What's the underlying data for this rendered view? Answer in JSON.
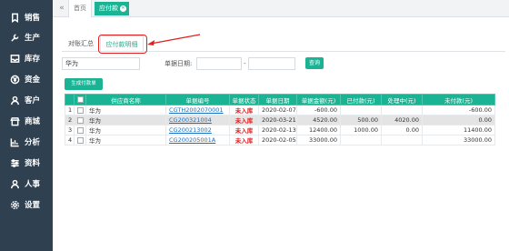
{
  "sidebar": {
    "items": [
      {
        "label": "销售",
        "icon": "bookmark-icon"
      },
      {
        "label": "生产",
        "icon": "wrench-icon"
      },
      {
        "label": "库存",
        "icon": "inbox-icon"
      },
      {
        "label": "资金",
        "icon": "cny-icon"
      },
      {
        "label": "客户",
        "icon": "user-icon"
      },
      {
        "label": "商城",
        "icon": "shop-icon"
      },
      {
        "label": "分析",
        "icon": "chart-icon"
      },
      {
        "label": "资料",
        "icon": "sliders-icon"
      },
      {
        "label": "人事",
        "icon": "user-icon"
      },
      {
        "label": "设置",
        "icon": "gear-icon"
      }
    ]
  },
  "topbar": {
    "collapse": "«",
    "tabs": [
      {
        "label": "首页"
      },
      {
        "label": "应付款"
      }
    ]
  },
  "subtabs": [
    {
      "label": "对账汇总"
    },
    {
      "label": "应付款明细"
    }
  ],
  "filter": {
    "supplier_value": "华为",
    "date_label": "单据日期:",
    "date_from": "",
    "date_sep": "-",
    "date_to": "",
    "query_label": "查询"
  },
  "generate_label": "生成付款单",
  "table": {
    "columns": [
      "",
      "",
      "供应商名称",
      "单据编号",
      "单据状态",
      "单据日期",
      "单据金额(元)",
      "已付款(元)",
      "处理中(元)",
      "未付款(元)"
    ],
    "rows": [
      {
        "no": "1",
        "supplier": "华为",
        "doc": "CGTH2002070001",
        "status": "未入库",
        "date": "2020-02-07",
        "amount": "-600.00",
        "paid": "",
        "processing": "",
        "unpaid": "-600.00"
      },
      {
        "no": "2",
        "supplier": "华为",
        "doc": "CG200321004",
        "status": "未入库",
        "date": "2020-03-21",
        "amount": "4520.00",
        "paid": "500.00",
        "processing": "4020.00",
        "unpaid": "0.00"
      },
      {
        "no": "3",
        "supplier": "华为",
        "doc": "CG200213002",
        "status": "未入库",
        "date": "2020-02-13",
        "amount": "12400.00",
        "paid": "1000.00",
        "processing": "0.00",
        "unpaid": "11400.00"
      },
      {
        "no": "4",
        "supplier": "华为",
        "doc": "CG200205001A",
        "status": "未入库",
        "date": "2020-02-05",
        "amount": "33000.00",
        "paid": "",
        "processing": "",
        "unpaid": "33000.00"
      }
    ]
  },
  "colors": {
    "accent": "#1ab394",
    "sidebar": "#2f4050",
    "alert": "#e02020",
    "link": "#1a6fc4"
  }
}
